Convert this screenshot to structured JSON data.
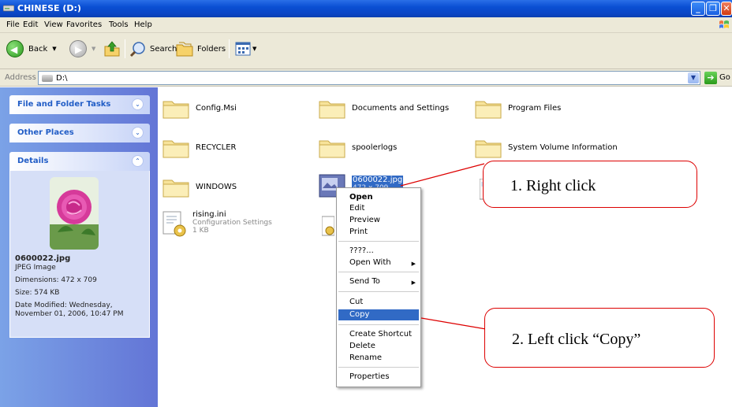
{
  "window": {
    "title": "CHINESE (D:)",
    "buttons": [
      "minimize",
      "maximize",
      "close"
    ]
  },
  "menubar": {
    "items": [
      "File",
      "Edit",
      "View",
      "Favorites",
      "Tools",
      "Help"
    ]
  },
  "toolbar": {
    "back_label": "Back",
    "search_label": "Search",
    "folders_label": "Folders"
  },
  "address": {
    "label": "Address",
    "value": "D:\\",
    "go_label": "Go"
  },
  "taskpane": {
    "file_tasks": "File and Folder Tasks",
    "other_places": "Other Places",
    "details": "Details",
    "details_info": {
      "filename": "0600022.jpg",
      "type": "JPEG Image",
      "dimensions": "Dimensions: 472 x 709",
      "size": "Size: 574 KB",
      "modified_1": "Date Modified: Wednesday,",
      "modified_2": "November 01, 2006, 10:47 PM"
    }
  },
  "files": [
    {
      "name": "Config.Msi"
    },
    {
      "name": "Documents and Settings"
    },
    {
      "name": "Program Files"
    },
    {
      "name": "RECYCLER"
    },
    {
      "name": "spoolerlogs"
    },
    {
      "name": "System Volume Information"
    },
    {
      "name": "WINDOWS"
    },
    {
      "name": "0600022.jpg",
      "sub": "472 x 709"
    },
    {
      "name": "rising.ini",
      "sub1": "Configuration Settings",
      "sub2": "1 KB"
    }
  ],
  "context_menu": {
    "open": "Open",
    "edit": "Edit",
    "preview": "Preview",
    "print": "Print",
    "unknown": "????...",
    "open_with": "Open With",
    "send_to": "Send To",
    "cut": "Cut",
    "copy": "Copy",
    "create_shortcut": "Create Shortcut",
    "delete": "Delete",
    "rename": "Rename",
    "properties": "Properties"
  },
  "callouts": {
    "step1": "1. Right click",
    "step2": "2. Left click “Copy”"
  },
  "colors": {
    "titlebar": "#0a4fd3",
    "taskpane": "#6f8ee0",
    "highlight": "#316ac5",
    "callout_border": "#dd0000"
  }
}
